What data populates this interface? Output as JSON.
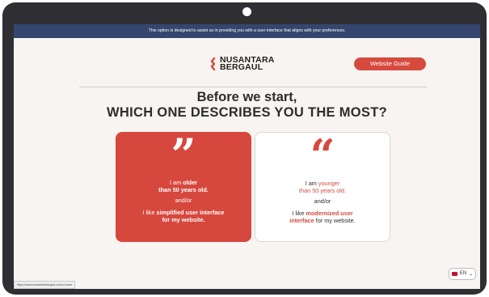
{
  "banner": {
    "text": "This option is designed to assist us in providing you with a user interface that aligns with your preferences."
  },
  "logo": {
    "line1": "NUSANTARA",
    "line2": "BERGAUL"
  },
  "guide_button": {
    "label": "Website Guide"
  },
  "headline": {
    "line1": "Before we start,",
    "line2": "WHICH ONE DESCRIBES YOU THE MOST?"
  },
  "cards": {
    "older": {
      "quote": "”",
      "i_am": "I am",
      "older": "older",
      "than": "than 50 years old.",
      "andor": "and/or",
      "i_like": "I like",
      "simplified": "simplified user interface",
      "for_site": "for my website."
    },
    "younger": {
      "quote": "“",
      "i_am": "I am",
      "younger": "younger",
      "than": "than 50 years old.",
      "andor": "and/or",
      "i_like": "I like",
      "modernized1": "modernized user",
      "interface": "interface",
      "for_site": "for my website."
    }
  },
  "language": {
    "code": "EN",
    "chevron": "⌄"
  },
  "status_url": "https://www.nusantarabergaul.com/c-home",
  "colors": {
    "accent": "#d64a3e",
    "banner": "#34466e",
    "device": "#2f2f33",
    "screen": "#f7f4f1"
  }
}
